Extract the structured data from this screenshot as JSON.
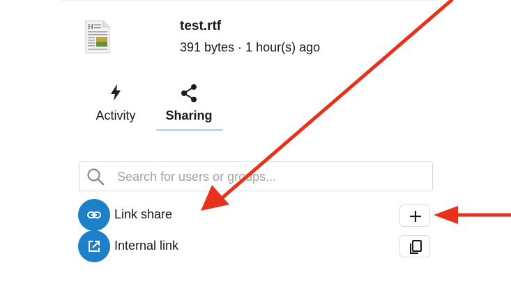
{
  "file": {
    "name": "test.rtf",
    "meta": "391 bytes · 1 hour(s) ago",
    "thumbnail_icon": "rtf-document-icon"
  },
  "tabs": [
    {
      "label": "Activity",
      "icon": "bolt-icon",
      "active": false
    },
    {
      "label": "Sharing",
      "icon": "share-icon",
      "active": true
    }
  ],
  "search": {
    "placeholder": "Search for users or groups...",
    "value": ""
  },
  "shares": [
    {
      "label": "Link share",
      "icon": "link-icon",
      "action_icon": "plus-icon"
    },
    {
      "label": "Internal link",
      "icon": "external-link-icon",
      "action_icon": "copy-icon"
    }
  ],
  "colors": {
    "accent": "#1d80c8",
    "annotation": "#e8311a",
    "tab_underline": "#a9c9ee"
  }
}
